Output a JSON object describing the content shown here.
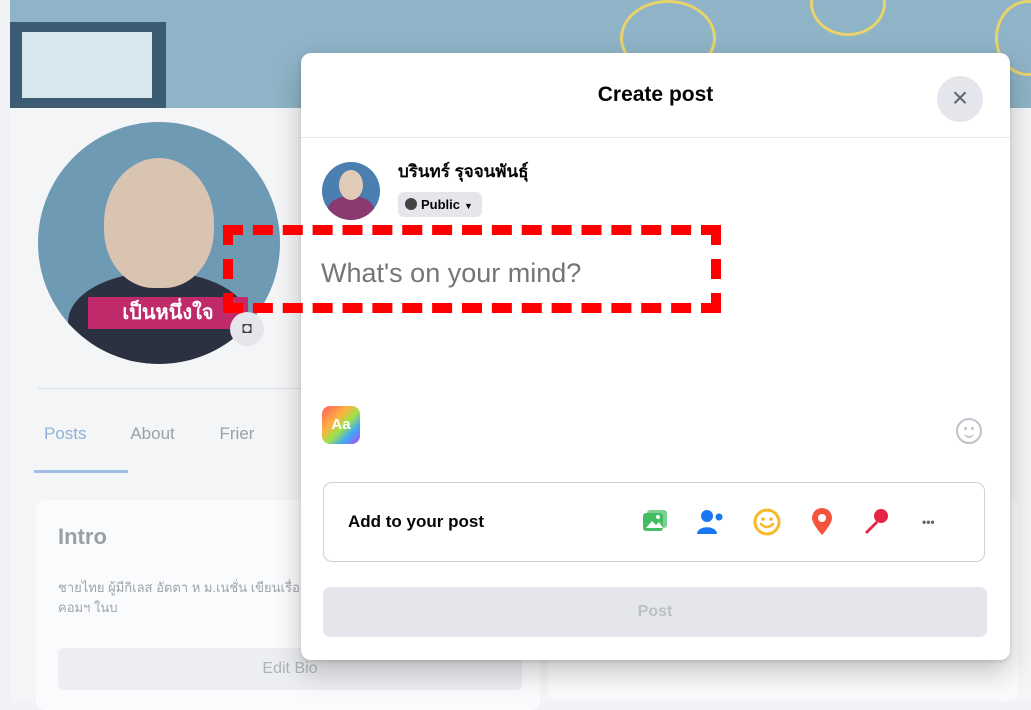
{
  "background": {
    "avatar_banner": "เป็นหนึ่งใจ",
    "tabs": [
      "Posts",
      "About",
      "Frier"
    ],
    "intro_title": "Intro",
    "intro_text": "ชายไทย ผู้มีกิเลส อัตตา ห ม.เนชั่น เขียนเรื่องคอมฯ ในบ",
    "edit_bio_label": "Edit Bio"
  },
  "modal": {
    "title": "Create post",
    "close_glyph": "×",
    "user_name": "บรินทร์ รุจจนพันธุ์",
    "privacy_label": "Public",
    "composer_placeholder": "What's on your mind?",
    "aa_label": "Aa",
    "add_to_post_label": "Add to your post",
    "add_icons": [
      "photo-video-icon",
      "tag-people-icon",
      "feeling-icon",
      "check-in-icon",
      "live-video-icon",
      "more-icon"
    ],
    "more_glyph": "•••",
    "post_label": "Post"
  },
  "colors": {
    "highlight": "#ff0000",
    "photo_green": "#45bd62",
    "tag_blue": "#1877f2",
    "feeling_yellow": "#f7b928",
    "checkin_red": "#f5533d",
    "live_red": "#e42645"
  }
}
